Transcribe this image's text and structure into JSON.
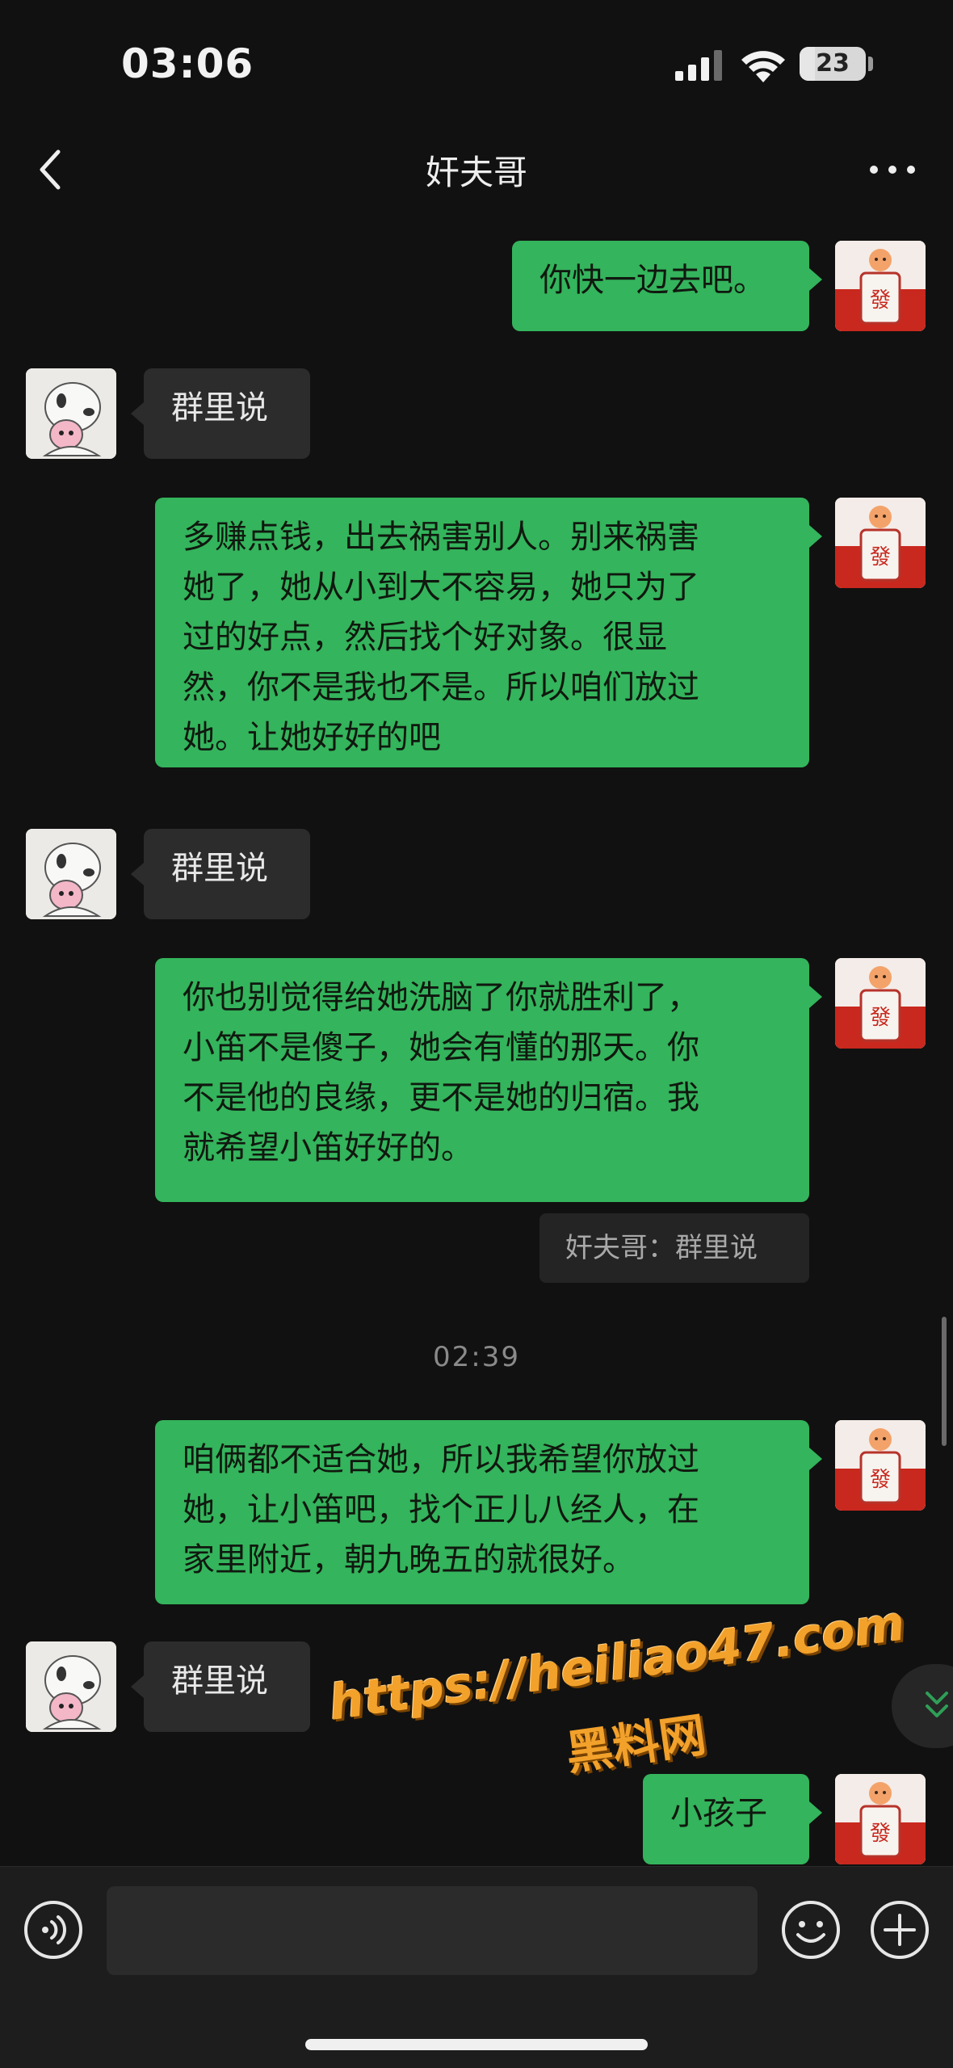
{
  "status_bar": {
    "time": "03:06",
    "battery": "23",
    "battery_fraction": 0.23
  },
  "nav": {
    "title": "奸夫哥"
  },
  "messages": [
    {
      "dir": "sent",
      "text": "你快一边去吧。"
    },
    {
      "dir": "recv",
      "text": "群里说"
    },
    {
      "dir": "sent",
      "text": "多赚点钱，出去祸害别人。别来祸害\n她了，她从小到大不容易，她只为了\n过的好点，然后找个好对象。很显\n然，你不是我也不是。所以咱们放过\n她。让她好好的吧"
    },
    {
      "dir": "recv",
      "text": "群里说"
    },
    {
      "dir": "sent",
      "text": "你也别觉得给她洗脑了你就胜利了，\n小笛不是傻子，她会有懂的那天。你\n不是他的良缘，更不是她的归宿。我\n就希望小笛好好的。"
    },
    {
      "dir": "sent",
      "text": "咱俩都不适合她，所以我希望你放过\n她，让小笛吧，找个正儿八经人，在\n家里附近，朝九晚五的就很好。"
    },
    {
      "dir": "recv",
      "text": "群里说"
    },
    {
      "dir": "sent",
      "text": "小孩子"
    }
  ],
  "quote": {
    "text": "奸夫哥：群里说"
  },
  "time_separator": "02:39",
  "watermark": {
    "line1": "https://heiliao47.com",
    "line2": "黑料网"
  },
  "icons": {
    "back": "chevron-left-icon",
    "more": "more-dots-icon",
    "voice": "voice-icon",
    "emoji": "emoji-icon",
    "plus": "plus-icon",
    "jump": "double-chevron-down-icon"
  },
  "colors": {
    "sent_bubble": "#34b45c",
    "recv_bubble": "#2c2c2c",
    "background": "#111111",
    "jump_icon": "#2f9e57"
  }
}
